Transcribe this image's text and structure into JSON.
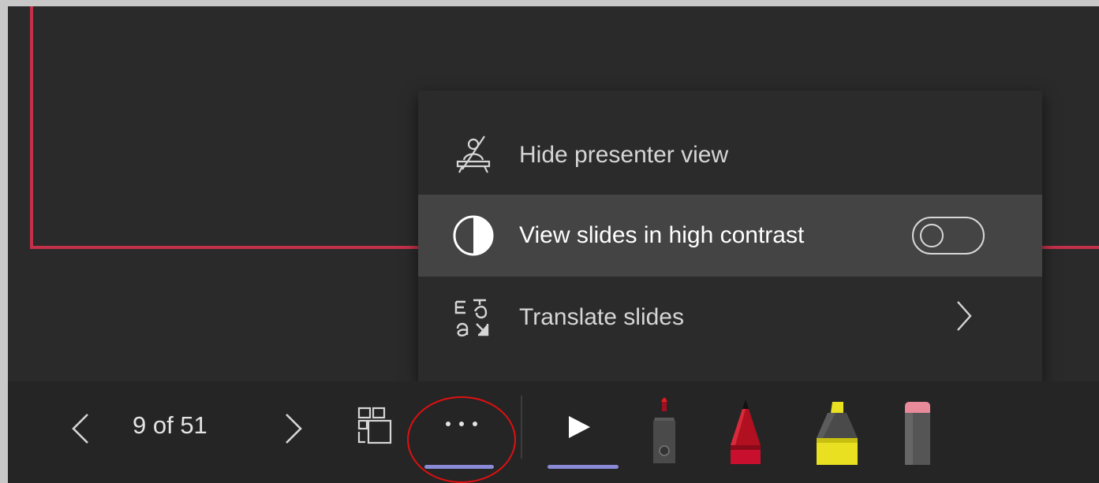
{
  "menu": {
    "items": [
      {
        "label": "Hide presenter view",
        "icon": "hide-presenter-icon"
      },
      {
        "label": "View slides in high contrast",
        "icon": "contrast-icon",
        "toggle": "off"
      },
      {
        "label": "Translate slides",
        "icon": "translate-icon"
      }
    ]
  },
  "toolbar": {
    "page_count": "9 of 51",
    "tools": [
      "prev-slide",
      "next-slide",
      "slide-grid",
      "more-options",
      "pointer",
      "laser-pointer",
      "pen",
      "highlighter",
      "eraser"
    ]
  },
  "colors": {
    "slide_border": "#c3304a",
    "active_underline": "#8a8ad6",
    "annotation_circle": "#e01010",
    "highlighter": "#e8e020",
    "pen": "#c8102e",
    "eraser_tip": "#e88a9a"
  }
}
